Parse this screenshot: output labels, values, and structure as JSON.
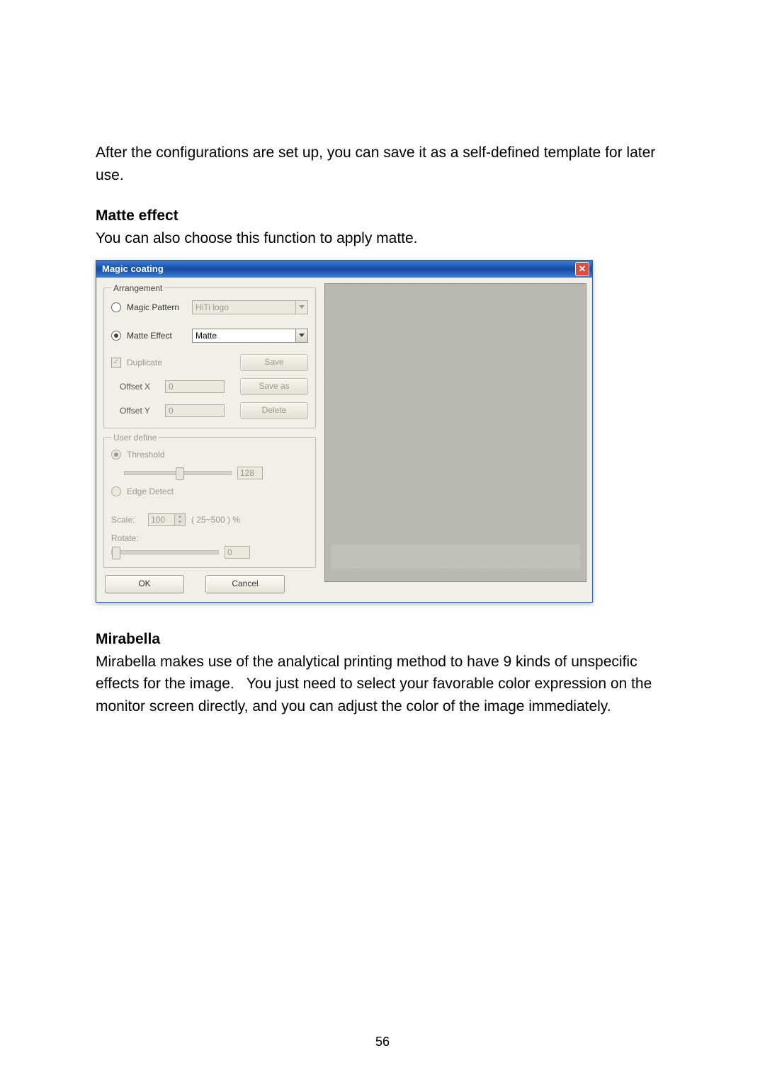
{
  "intro_text": "After the configurations are set up, you can save it as a self-defined template for later use.",
  "matte_heading": "Matte effect",
  "matte_text": "You can also choose this function to apply matte.",
  "mirabella_heading": "Mirabella",
  "mirabella_text": "Mirabella makes use of the analytical printing method to have 9 kinds of unspecific effects for the image.   You just need to select your favorable color expression on the monitor screen directly, and you can adjust the color of the image immediately.",
  "page_number": "56",
  "dialog": {
    "title": "Magic coating",
    "arrangement": {
      "legend": "Arrangement",
      "magic_pattern_label": "Magic Pattern",
      "magic_pattern_selected": "HiTi logo",
      "matte_effect_label": "Matte Effect",
      "matte_effect_selected": "Matte",
      "duplicate_label": "Duplicate",
      "save_label": "Save",
      "offset_x_label": "Offset X",
      "offset_x_value": "0",
      "save_as_label": "Save as",
      "offset_y_label": "Offset Y",
      "offset_y_value": "0",
      "delete_label": "Delete"
    },
    "user_define": {
      "legend": "User define",
      "threshold_label": "Threshold",
      "threshold_value": "128",
      "edge_detect_label": "Edge Detect",
      "scale_label": "Scale:",
      "scale_value": "100",
      "scale_range": "( 25~500 ) %",
      "rotate_label": "Rotate:",
      "rotate_value": "0"
    },
    "ok_label": "OK",
    "cancel_label": "Cancel"
  }
}
